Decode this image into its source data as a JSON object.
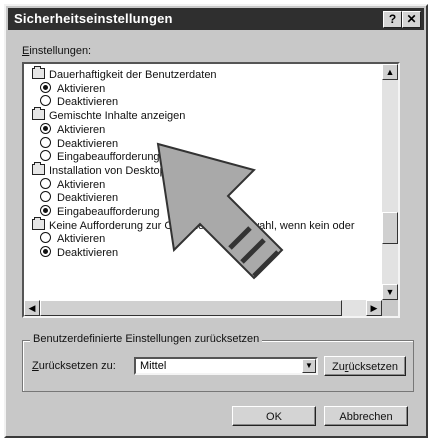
{
  "window": {
    "title": "Sicherheitseinstellungen",
    "help": "?",
    "close": "✕"
  },
  "settings_label_first": "E",
  "settings_label_rest": "instellungen:",
  "tree": [
    {
      "kind": "folder",
      "text": "Dauerhaftigkeit der Benutzerdaten"
    },
    {
      "kind": "radio",
      "on": true,
      "text": "Aktivieren"
    },
    {
      "kind": "radio",
      "on": false,
      "text": "Deaktivieren"
    },
    {
      "kind": "folder",
      "text": "Gemischte Inhalte anzeigen"
    },
    {
      "kind": "radio",
      "on": true,
      "text": "Aktivieren"
    },
    {
      "kind": "radio",
      "on": false,
      "text": "Deaktivieren"
    },
    {
      "kind": "radio",
      "on": false,
      "text": "Eingabeaufforderung"
    },
    {
      "kind": "folder",
      "text": "Installation von Desktopobjekten"
    },
    {
      "kind": "radio",
      "on": false,
      "text": "Aktivieren"
    },
    {
      "kind": "radio",
      "on": false,
      "text": "Deaktivieren"
    },
    {
      "kind": "radio",
      "on": true,
      "text": "Eingabeaufforderung"
    },
    {
      "kind": "folder",
      "text": "Keine Aufforderung zur Clientzertifikatauswahl, wenn kein oder"
    },
    {
      "kind": "radio",
      "on": false,
      "text": "Aktivieren"
    },
    {
      "kind": "radio",
      "on": true,
      "text": "Deaktivieren"
    }
  ],
  "reset_group": {
    "title": "Benutzerdefinierte Einstellungen zurücksetzen",
    "reset_to_first": "Z",
    "reset_to_rest": "urücksetzen zu:",
    "level_value": "Mittel",
    "reset_button_pre": "Zu",
    "reset_button_u": "r",
    "reset_button_post": "ücksetzen"
  },
  "buttons": {
    "ok": "OK",
    "cancel": "Abbrechen"
  },
  "icons": {
    "scroll_up": "arrow-up-icon",
    "scroll_down": "arrow-down-icon",
    "scroll_left": "arrow-left-icon",
    "scroll_right": "arrow-right-icon",
    "pointer": "pointing-arrow-icon"
  }
}
